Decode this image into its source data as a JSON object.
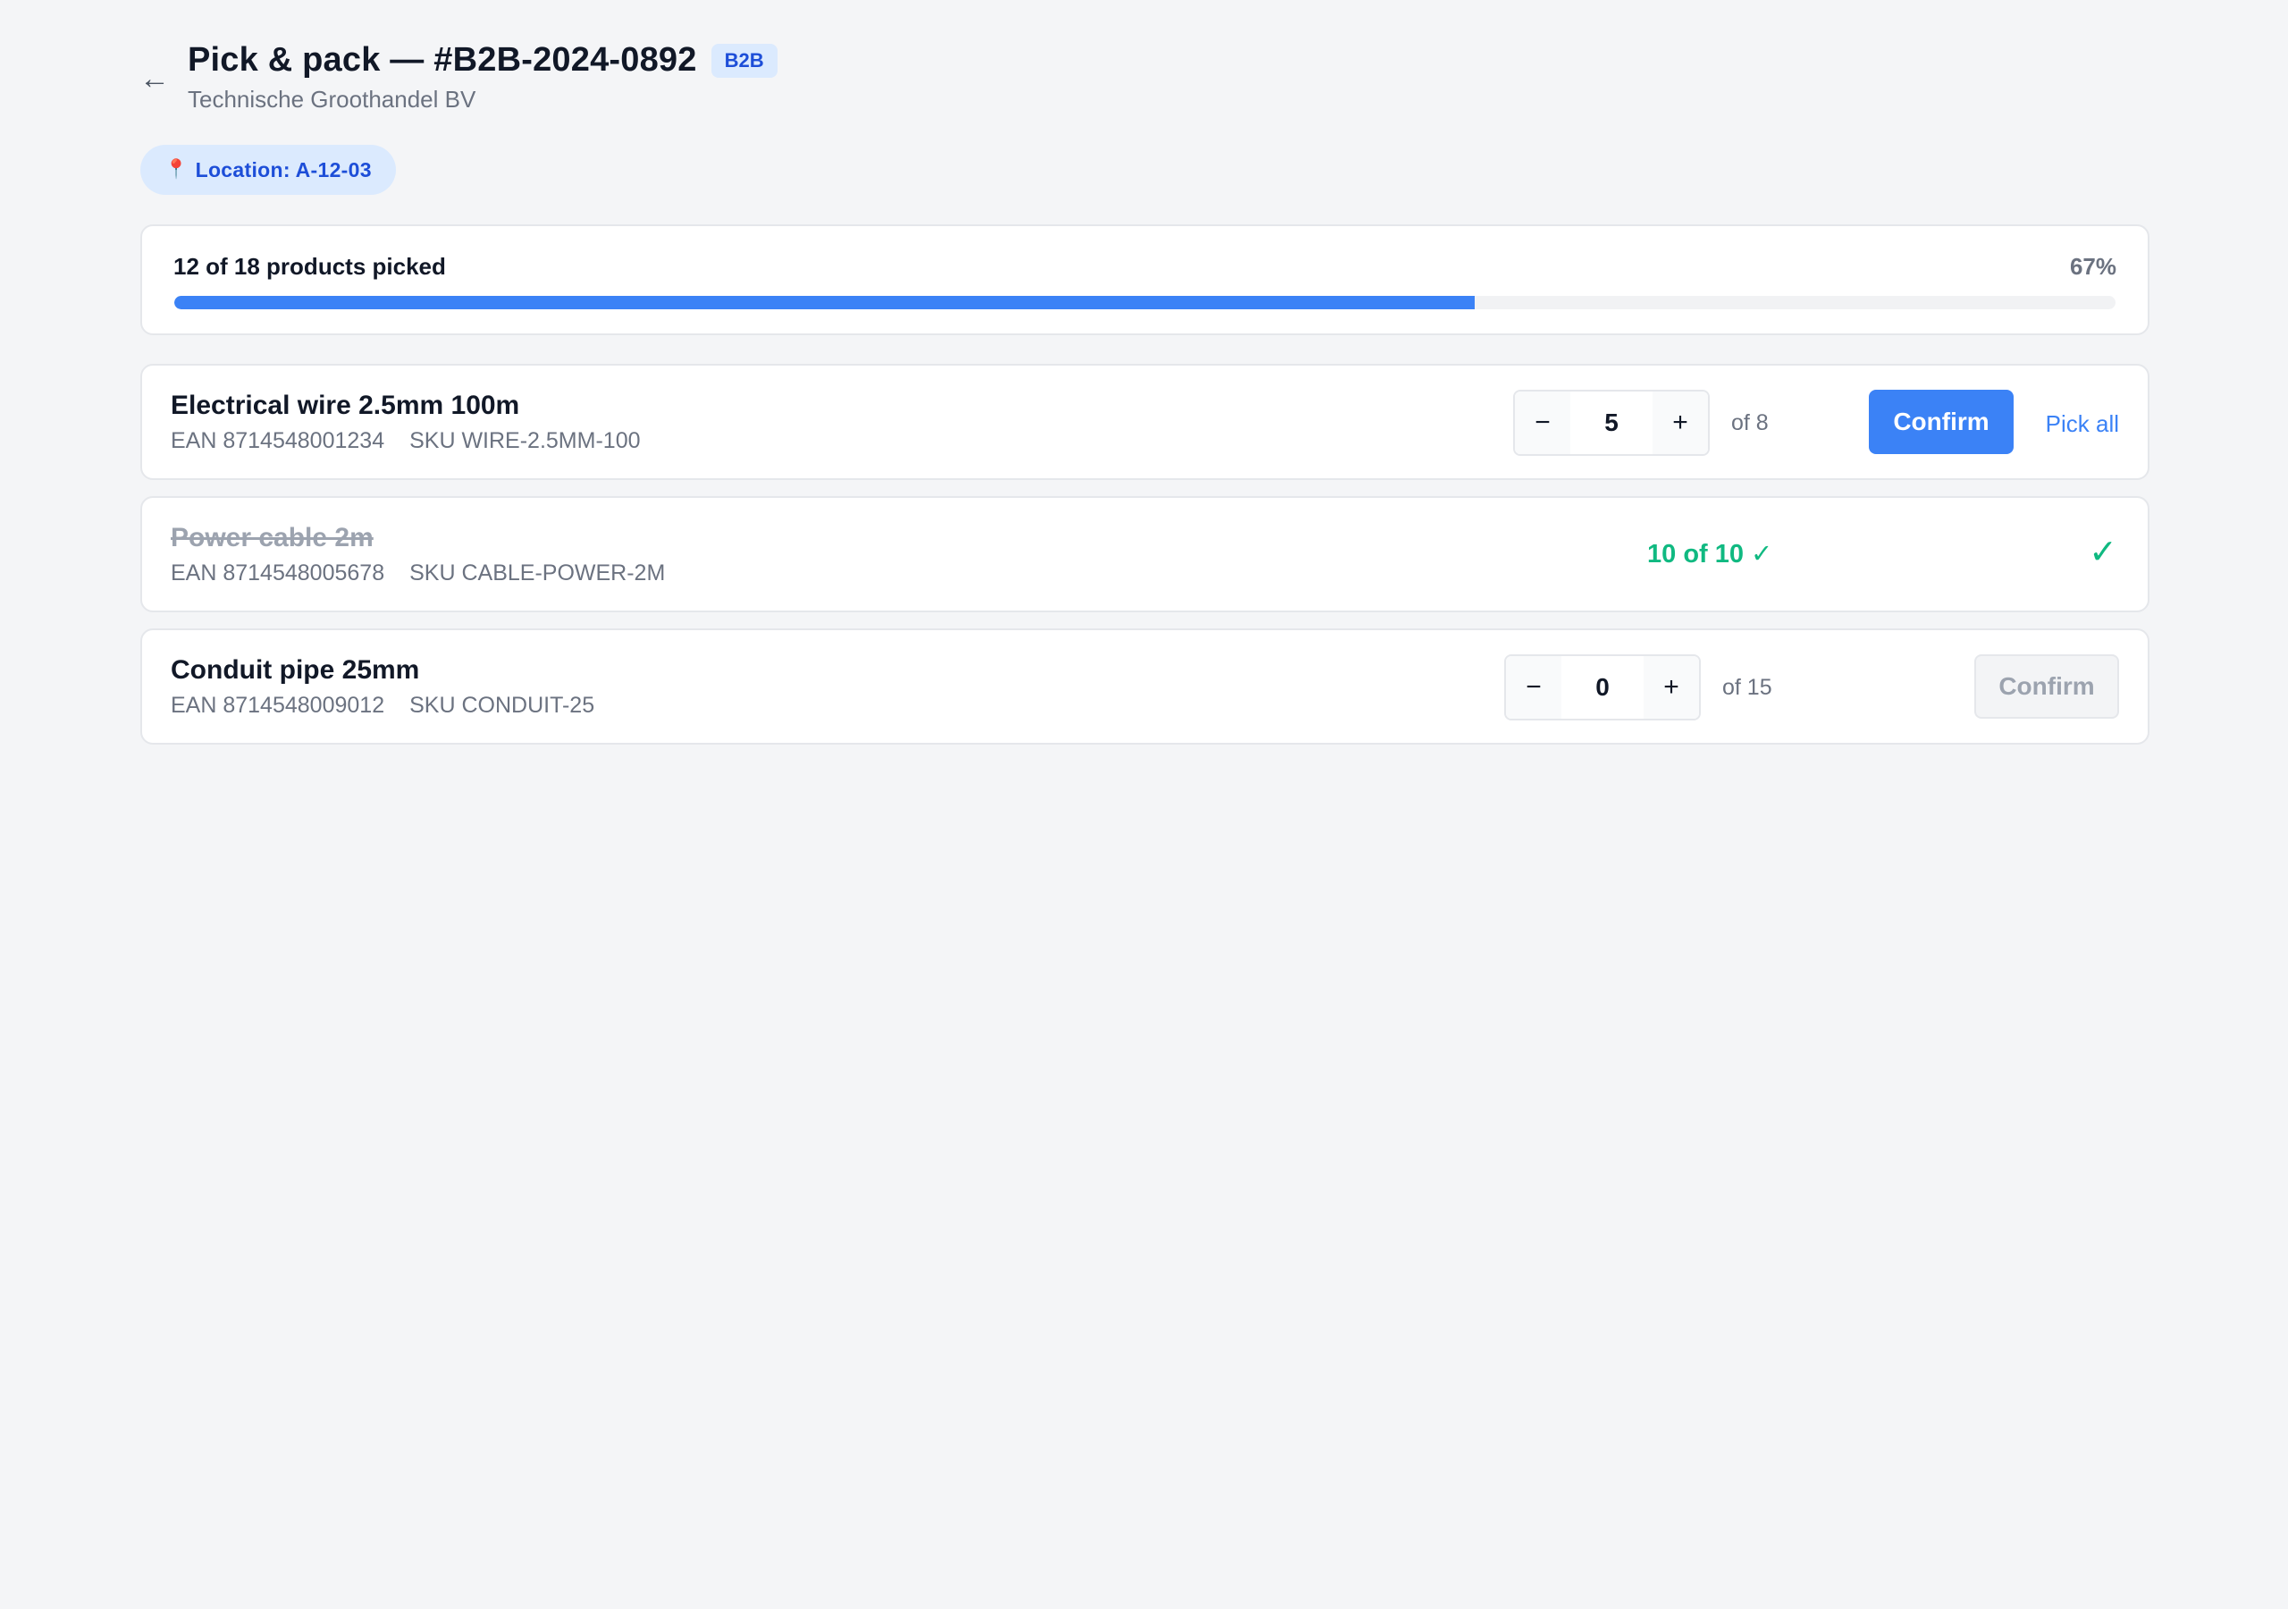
{
  "header": {
    "title": "Pick & pack — #B2B-2024-0892",
    "badge": "B2B",
    "subtitle": "Technische Groothandel BV",
    "back_icon": "arrow-left"
  },
  "location": {
    "label": "Location: A-12-03",
    "icon": "map-pin"
  },
  "progress": {
    "label": "12 of 18 products picked",
    "percent_label": "67%",
    "fraction": 0.67
  },
  "items": [
    {
      "name": "Electrical wire 2.5mm 100m",
      "ean": "EAN 8714548001234",
      "sku": "SKU WIRE-2.5MM-100",
      "decrement": "−",
      "increment": "+",
      "quantity": "5",
      "of_total": "of 8",
      "confirm_label": "Confirm",
      "pick_all_label": "Pick all",
      "confirm_state": "active"
    },
    {
      "name": "Power cable 2m",
      "ean": "EAN 8714548005678",
      "sku": "SKU CABLE-POWER-2M",
      "done_label": "10 of 10 ✓",
      "done_check": "✓",
      "state": "completed"
    },
    {
      "name": "Conduit pipe 25mm",
      "ean": "EAN 8714548009012",
      "sku": "SKU CONDUIT-25",
      "decrement": "−",
      "increment": "+",
      "quantity": "0",
      "of_total": "of 15",
      "confirm_label": "Confirm",
      "confirm_state": "disabled"
    }
  ],
  "colors": {
    "accent": "#3b82f6",
    "success": "#10b981",
    "badge_bg": "#dbeafe",
    "badge_text": "#1d4ed8",
    "background": "#f4f5f7"
  }
}
